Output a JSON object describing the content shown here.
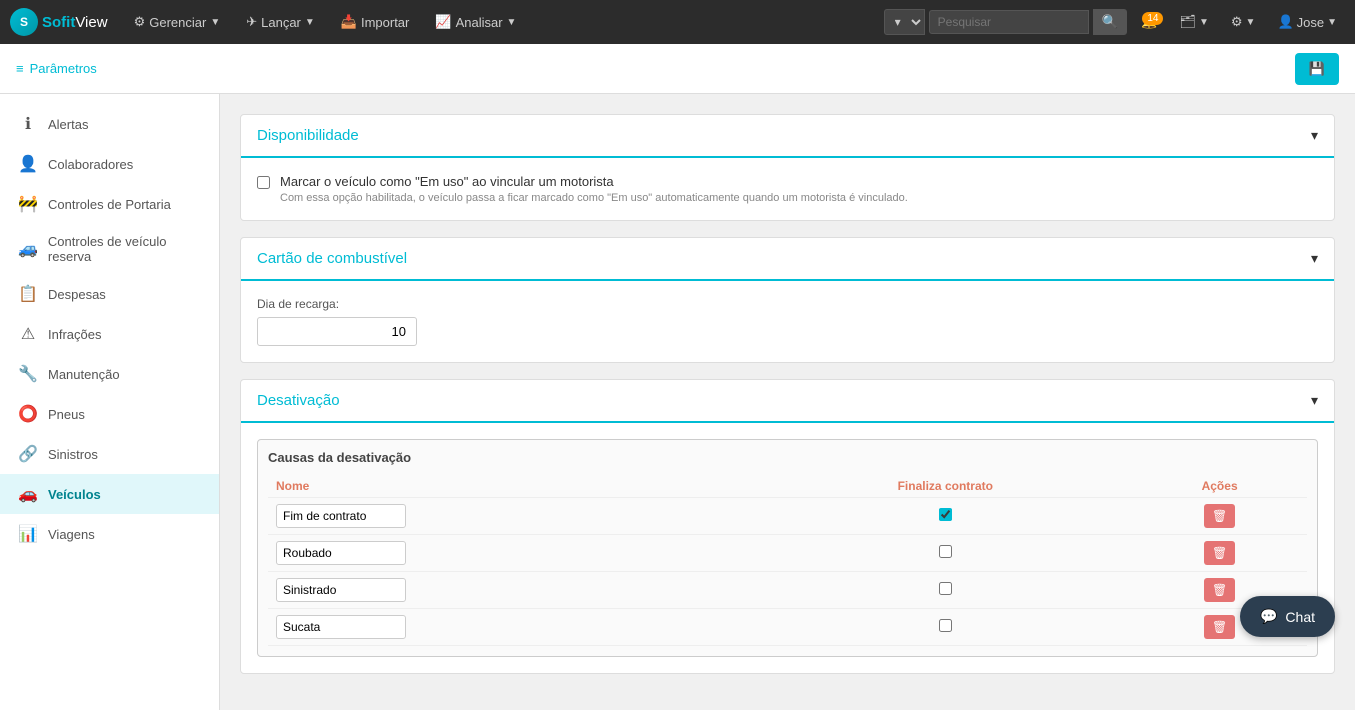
{
  "brand": {
    "logo_text": "S",
    "name_start": "Sofit",
    "name_end": "View"
  },
  "topnav": {
    "gerenciar": "Gerenciar",
    "lancar": "Lançar",
    "importar": "Importar",
    "analisar": "Analisar",
    "search_placeholder": "Pesquisar",
    "notifications_badge": "14",
    "user_name": "Jose"
  },
  "subheader": {
    "parametros": "Parâmetros",
    "save_icon": "💾"
  },
  "sidebar": {
    "items": [
      {
        "label": "Alertas",
        "icon": "ℹ️",
        "active": false
      },
      {
        "label": "Colaboradores",
        "icon": "👤",
        "active": false
      },
      {
        "label": "Controles de Portaria",
        "icon": "🚧",
        "active": false
      },
      {
        "label": "Controles de veículo reserva",
        "icon": "🚙",
        "active": false
      },
      {
        "label": "Despesas",
        "icon": "📋",
        "active": false
      },
      {
        "label": "Infrações",
        "icon": "⚠️",
        "active": false
      },
      {
        "label": "Manutenção",
        "icon": "🔧",
        "active": false
      },
      {
        "label": "Pneus",
        "icon": "⭕",
        "active": false
      },
      {
        "label": "Sinistros",
        "icon": "🔗",
        "active": false
      },
      {
        "label": "Veículos",
        "icon": "🚗",
        "active": true
      },
      {
        "label": "Viagens",
        "icon": "📊",
        "active": false
      }
    ]
  },
  "sections": {
    "disponibilidade": {
      "title": "Disponibilidade",
      "checkbox_label": "Marcar o veículo como \"Em uso\" ao vincular um motorista",
      "checkbox_desc": "Com essa opção habilitada, o veículo passa a ficar marcado como \"Em uso\" automaticamente quando um motorista é vinculado.",
      "checked": false
    },
    "cartao_combustivel": {
      "title": "Cartão de combustível",
      "dia_label": "Dia de recarga:",
      "dia_value": "10"
    },
    "desativacao": {
      "title": "Desativação",
      "table_title": "Causas da desativação",
      "col_nome": "Nome",
      "col_finaliza": "Finaliza contrato",
      "col_acoes": "Ações",
      "rows": [
        {
          "nome": "Fim de contrato",
          "finaliza": true
        },
        {
          "nome": "Roubado",
          "finaliza": false
        },
        {
          "nome": "Sinistrado",
          "finaliza": false
        },
        {
          "nome": "Sucata",
          "finaliza": false
        }
      ]
    }
  },
  "chat": {
    "label": "Chat"
  }
}
